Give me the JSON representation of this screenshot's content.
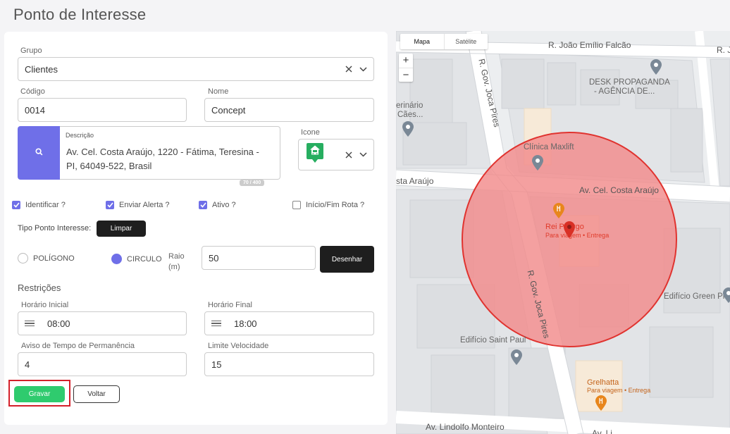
{
  "page_title": "Ponto de Interesse",
  "form": {
    "grupo": {
      "label": "Grupo",
      "value": "Clientes"
    },
    "codigo": {
      "label": "Código",
      "value": "0014"
    },
    "nome": {
      "label": "Nome",
      "value": "Concept"
    },
    "descricao": {
      "label": "Descrição",
      "value": "Av. Cel. Costa Araújo, 1220 - Fátima, Teresina - PI, 64049-522, Brasil",
      "counter": "70 / 400"
    },
    "icone": {
      "label": "Icone"
    },
    "checks": [
      {
        "label": "Identificar ?",
        "checked": true
      },
      {
        "label": "Enviar Alerta ?",
        "checked": true
      },
      {
        "label": "Ativo ?",
        "checked": true
      },
      {
        "label": "Início/Fim Rota ?",
        "checked": false
      }
    ],
    "tipo": {
      "label": "Tipo Ponto Interesse:",
      "limpar": "Limpar"
    },
    "poligono": "POLÍGONO",
    "circulo": "CIRCULO",
    "raio": {
      "label": "Raio (m)",
      "value": "50"
    },
    "desenhar": "Desenhar",
    "restricoes": "Restrições",
    "horario_inicial": {
      "label": "Horário Inicial",
      "value": "08:00"
    },
    "horario_final": {
      "label": "Horário Final",
      "value": "18:00"
    },
    "aviso": {
      "label": "Aviso de Tempo de Permanência",
      "value": "4"
    },
    "limite": {
      "label": "Limite Velocidade",
      "value": "15"
    },
    "gravar": "Gravar",
    "voltar": "Voltar"
  },
  "map": {
    "type_tabs": [
      "Mapa",
      "Satélite"
    ],
    "zoom_in": "+",
    "zoom_out": "−",
    "streets": {
      "joao_emilio": "R. João Emílio Falcão",
      "r_top_right": "R. J",
      "gov_joca_top": "R. Gov. Joca Pires",
      "costa_araujo_left": "sta Araújo",
      "costa_araujo_right": "Av. Cel. Costa Araújo",
      "gov_joca_bottom": "R. Gov. Joca Pires",
      "lindolfo": "Av. Lindolfo Monteiro",
      "bottom_cut": "Av. Li"
    },
    "pois": {
      "desk_1": "DESK PROPAGANDA",
      "desk_2": "- AGÊNCIA DE...",
      "vet_1": "erinário",
      "vet_2": "Cães...",
      "clinica": "Clínica Maxlift",
      "rei_1": "Rei P",
      "rei_2": "rgo",
      "rei_sub": "Para viagem • Entrega",
      "green_place": "Edifício Green Place",
      "saint_paul": "Edifício Saint Paul",
      "grelhatta": "Grelhatta",
      "grelhatta_sub": "Para viagem • Entrega"
    },
    "colors": {
      "circle_fill": "#f28b8b",
      "circle_stroke": "#e0332f",
      "accent": "#6f6fe8",
      "save": "#2fcb6e"
    }
  }
}
